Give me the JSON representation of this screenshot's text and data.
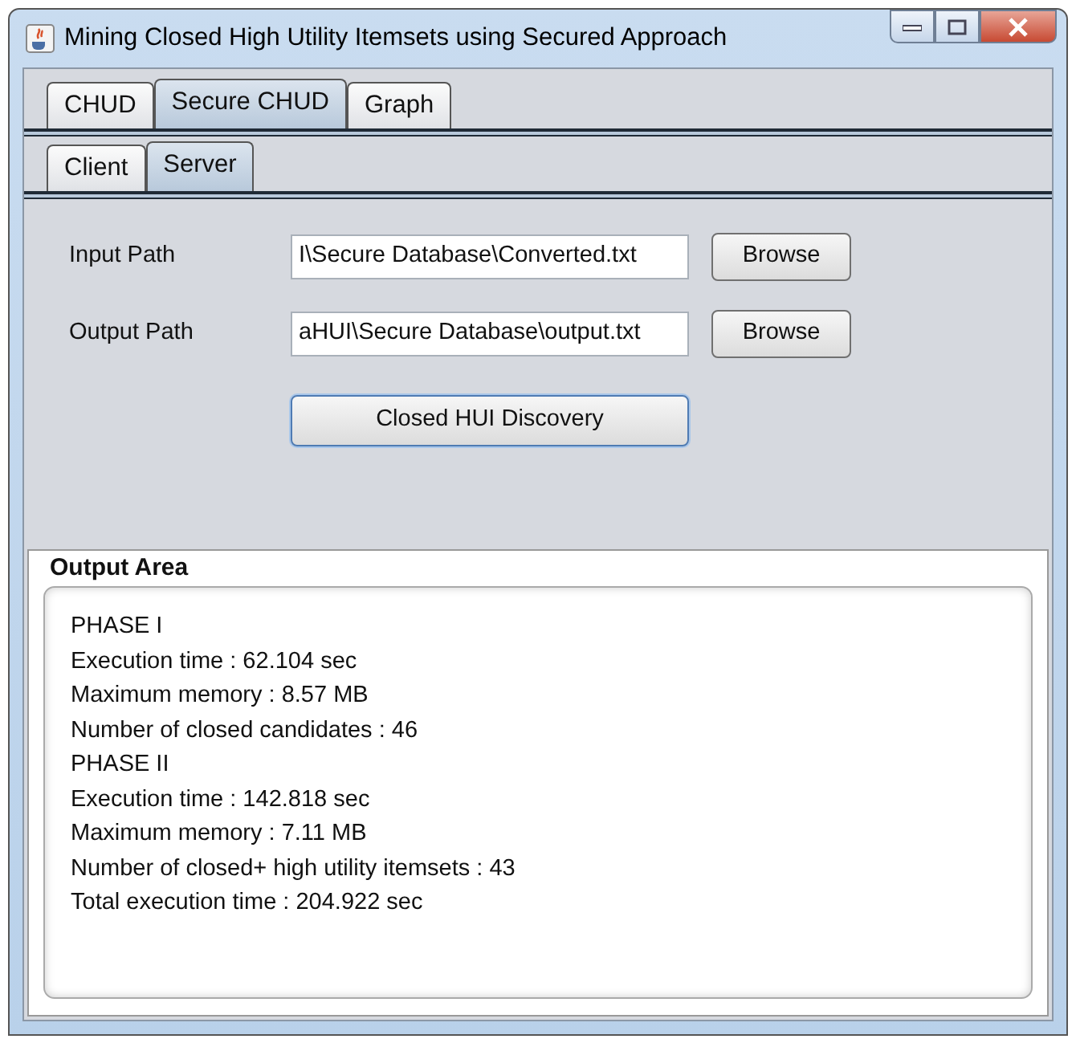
{
  "window": {
    "title": "Mining Closed High Utility Itemsets using Secured Approach"
  },
  "tabs": [
    {
      "label": "CHUD",
      "selected": false
    },
    {
      "label": "Secure CHUD",
      "selected": true
    },
    {
      "label": "Graph",
      "selected": false
    }
  ],
  "subtabs": [
    {
      "label": "Client",
      "selected": false
    },
    {
      "label": "Server",
      "selected": true
    }
  ],
  "fields": [
    {
      "label": "Input Path",
      "value": "I\\Secure Database\\Converted.txt",
      "button": "Browse"
    },
    {
      "label": "Output Path",
      "value": "aHUI\\Secure Database\\output.txt",
      "button": "Browse"
    }
  ],
  "action_button": "Closed HUI Discovery",
  "output_area": {
    "title": "Output Area",
    "lines": [
      "PHASE I",
      "Execution time : 62.104 sec",
      "Maximum memory : 8.57 MB",
      "Number of closed candidates : 46",
      "PHASE II",
      "Execution time : 142.818 sec",
      "Maximum memory : 7.11 MB",
      "Number of closed+ high utility itemsets : 43",
      "Total execution time : 204.922 sec"
    ]
  }
}
